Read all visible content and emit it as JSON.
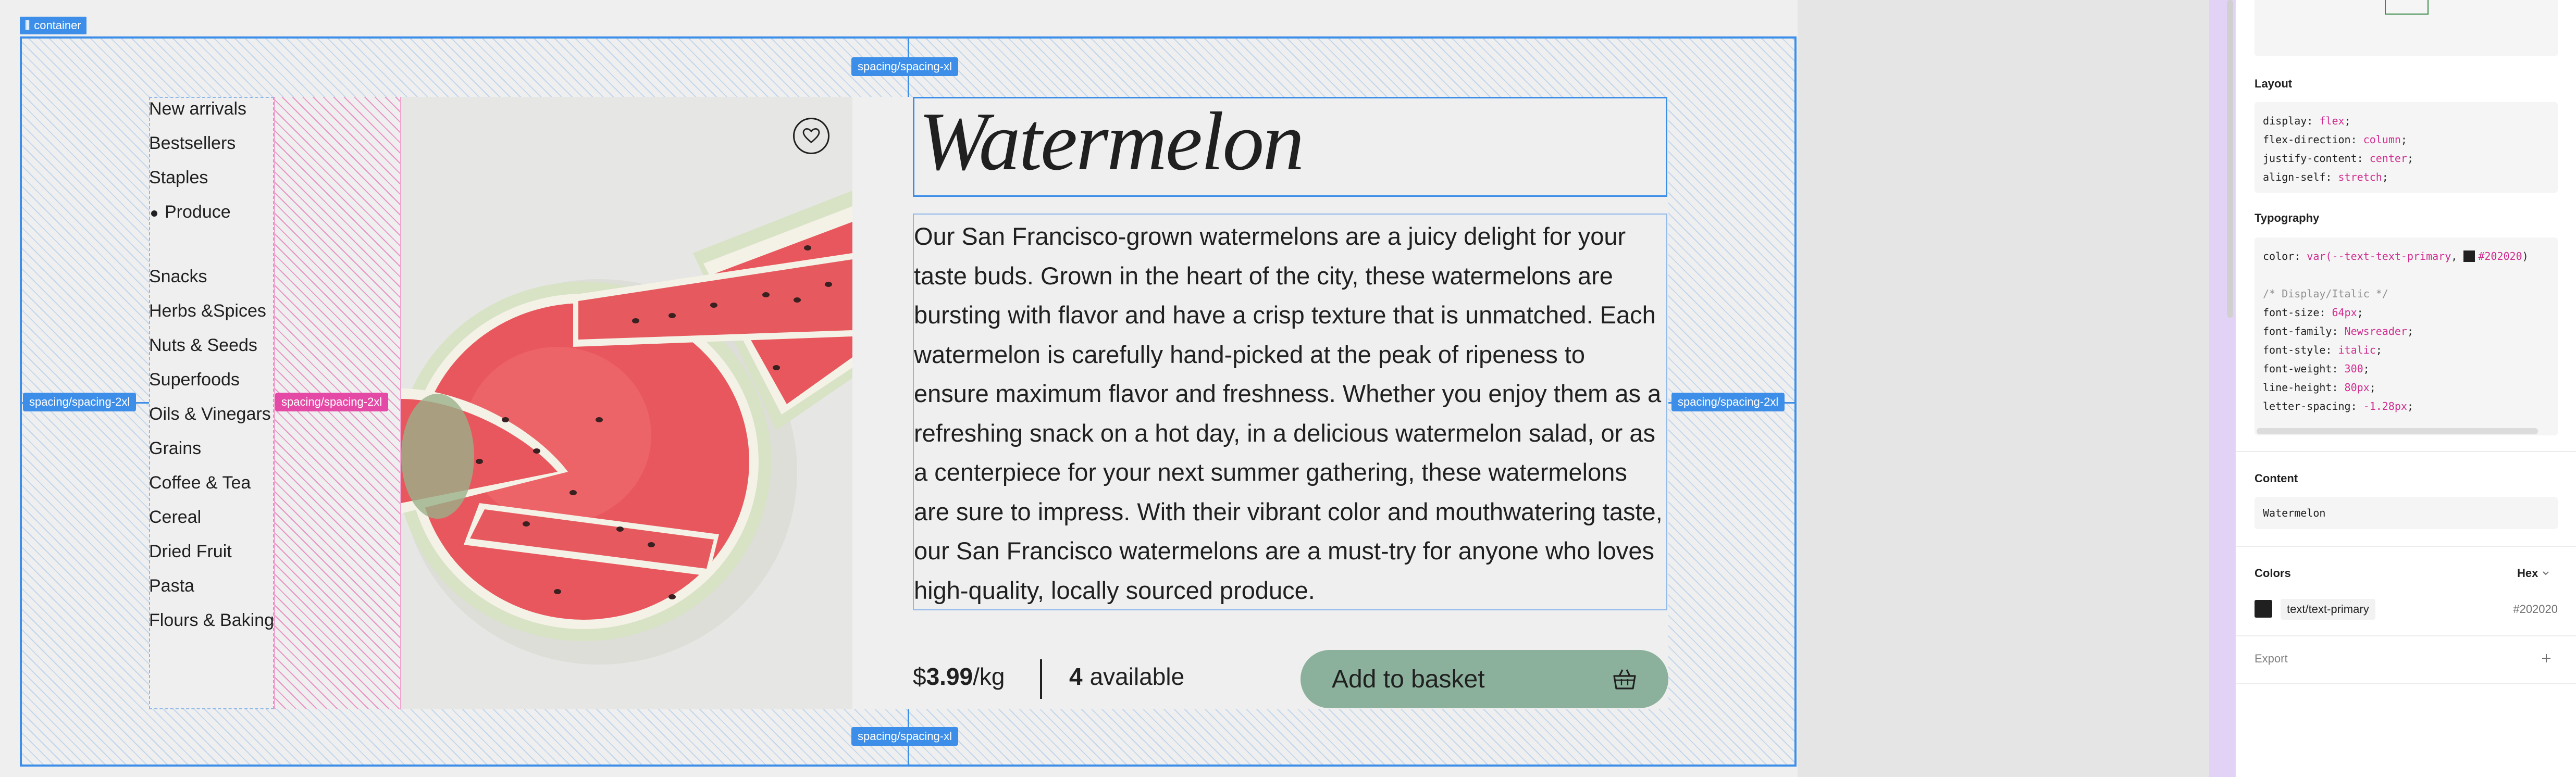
{
  "canvas": {
    "container_tag": "container",
    "spacing_labels": {
      "top": "spacing/spacing-xl",
      "bottom": "spacing/spacing-xl",
      "left": "spacing/spacing-2xl",
      "middle": "spacing/spacing-2xl",
      "right": "spacing/spacing-2xl"
    }
  },
  "sidebar": {
    "categories": [
      "New arrivals",
      "Bestsellers",
      "Staples",
      "Produce",
      "Snacks",
      "Herbs &Spices",
      "Nuts & Seeds",
      "Superfoods",
      "Oils & Vinegars",
      "Grains",
      "Coffee & Tea",
      "Cereal",
      "Dried Fruit",
      "Pasta",
      "Flours & Baking"
    ],
    "active": "Produce"
  },
  "product": {
    "title": "Watermelon",
    "description": "Our San Francisco-grown watermelons are a juicy delight for your taste buds. Grown in the heart of the city, these watermelons are bursting with flavor and have a crisp texture that is unmatched. Each watermelon is carefully hand-picked at the peak of ripeness to ensure maximum flavor and freshness. Whether you enjoy them as a refreshing snack on a hot day, in a delicious watermelon salad, or as a centerpiece for your next summer gathering, these watermelons are sure to impress. With their vibrant color and mouthwatering taste, our San Francisco watermelons are a must-try for anyone who loves high-quality, locally sourced produce.",
    "price_currency": "$",
    "price_amount": "3.99",
    "price_unit": "/kg",
    "available_count": "4",
    "available_label": "available",
    "add_button": "Add to basket",
    "favorite_icon": "heart-icon",
    "basket_icon": "basket-icon"
  },
  "inspector": {
    "layout": {
      "title": "Layout",
      "lines": [
        {
          "prop": "display: ",
          "val": "flex",
          "end": ";"
        },
        {
          "prop": "flex-direction: ",
          "val": "column",
          "end": ";"
        },
        {
          "prop": "justify-content: ",
          "val": "center",
          "end": ";"
        },
        {
          "prop": "align-self: ",
          "val": "stretch",
          "end": ";"
        }
      ]
    },
    "typography": {
      "title": "Typography",
      "color_prop": "color: ",
      "color_fn": "var(",
      "color_var": "--text-text-primary",
      "color_sep": ", ",
      "color_hex": "#202020",
      "color_end": ")",
      "comment": "/* Display/Italic */",
      "lines": [
        {
          "prop": "font-size: ",
          "val": "64px",
          "end": ";"
        },
        {
          "prop": "font-family: ",
          "val": "Newsreader",
          "end": ";"
        },
        {
          "prop": "font-style: ",
          "val": "italic",
          "end": ";"
        },
        {
          "prop": "font-weight: ",
          "val": "300",
          "end": ";"
        },
        {
          "prop": "line-height: ",
          "val": "80px",
          "end": ";"
        },
        {
          "prop": "letter-spacing: ",
          "val": "-1.28px",
          "end": ";"
        }
      ]
    },
    "content": {
      "title": "Content",
      "value": "Watermelon"
    },
    "colors": {
      "title": "Colors",
      "format": "Hex",
      "items": [
        {
          "name": "text/text-primary",
          "hex": "#202020"
        }
      ]
    },
    "export": {
      "title": "Export",
      "add_icon": "plus-icon"
    }
  }
}
